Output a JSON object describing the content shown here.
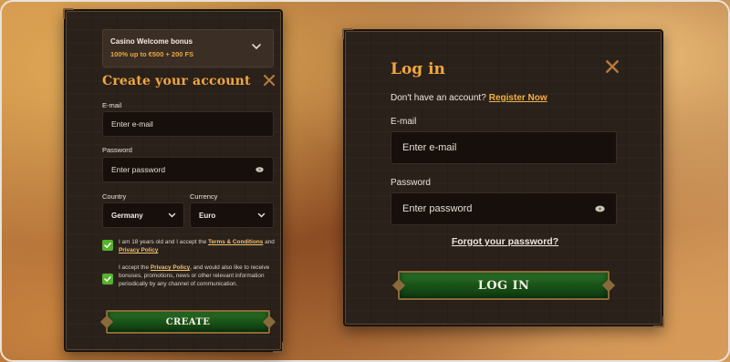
{
  "register": {
    "bonus_title": "Casino Welcome bonus",
    "bonus_subtitle": "100% up to €500 + 200 FS",
    "title": "Create your account",
    "email_label": "E-mail",
    "email_placeholder": "Enter e-mail",
    "password_label": "Password",
    "password_placeholder": "Enter password",
    "country_label": "Country",
    "country_value": "Germany",
    "currency_label": "Currency",
    "currency_value": "Euro",
    "terms_prefix": "I am 18 years old and I accept the ",
    "terms_link": "Terms & Conditions",
    "terms_and": " and ",
    "terms_privacy_link": "Privacy Policy",
    "promo_prefix": "I accept the ",
    "promo_link": "Privacy Policy",
    "promo_suffix": ", and would also like to receive bonuses, promotions, news or other relevant information periodically by any channel of communication.",
    "create_label": "CREATE"
  },
  "login": {
    "title": "Log in",
    "no_account_text": "Don't have an account?",
    "register_link": "Register Now",
    "email_label": "E-mail",
    "email_placeholder": "Enter e-mail",
    "password_label": "Password",
    "password_placeholder": "Enter password",
    "forgot_link": "Forgot your password?",
    "login_label": "LOG IN"
  },
  "colors": {
    "accent_orange": "#f1a63e",
    "panel_bg": "#2a211b",
    "input_bg": "#160f0b",
    "button_green": "#1b5519",
    "checkbox_green": "#56b22c"
  },
  "icons": {
    "bonus_toggle": "chevron-down-icon",
    "close": "close-icon",
    "password_toggle": "eye-icon",
    "select_arrow": "chevron-down-icon",
    "checkbox": "checkmark-icon"
  }
}
